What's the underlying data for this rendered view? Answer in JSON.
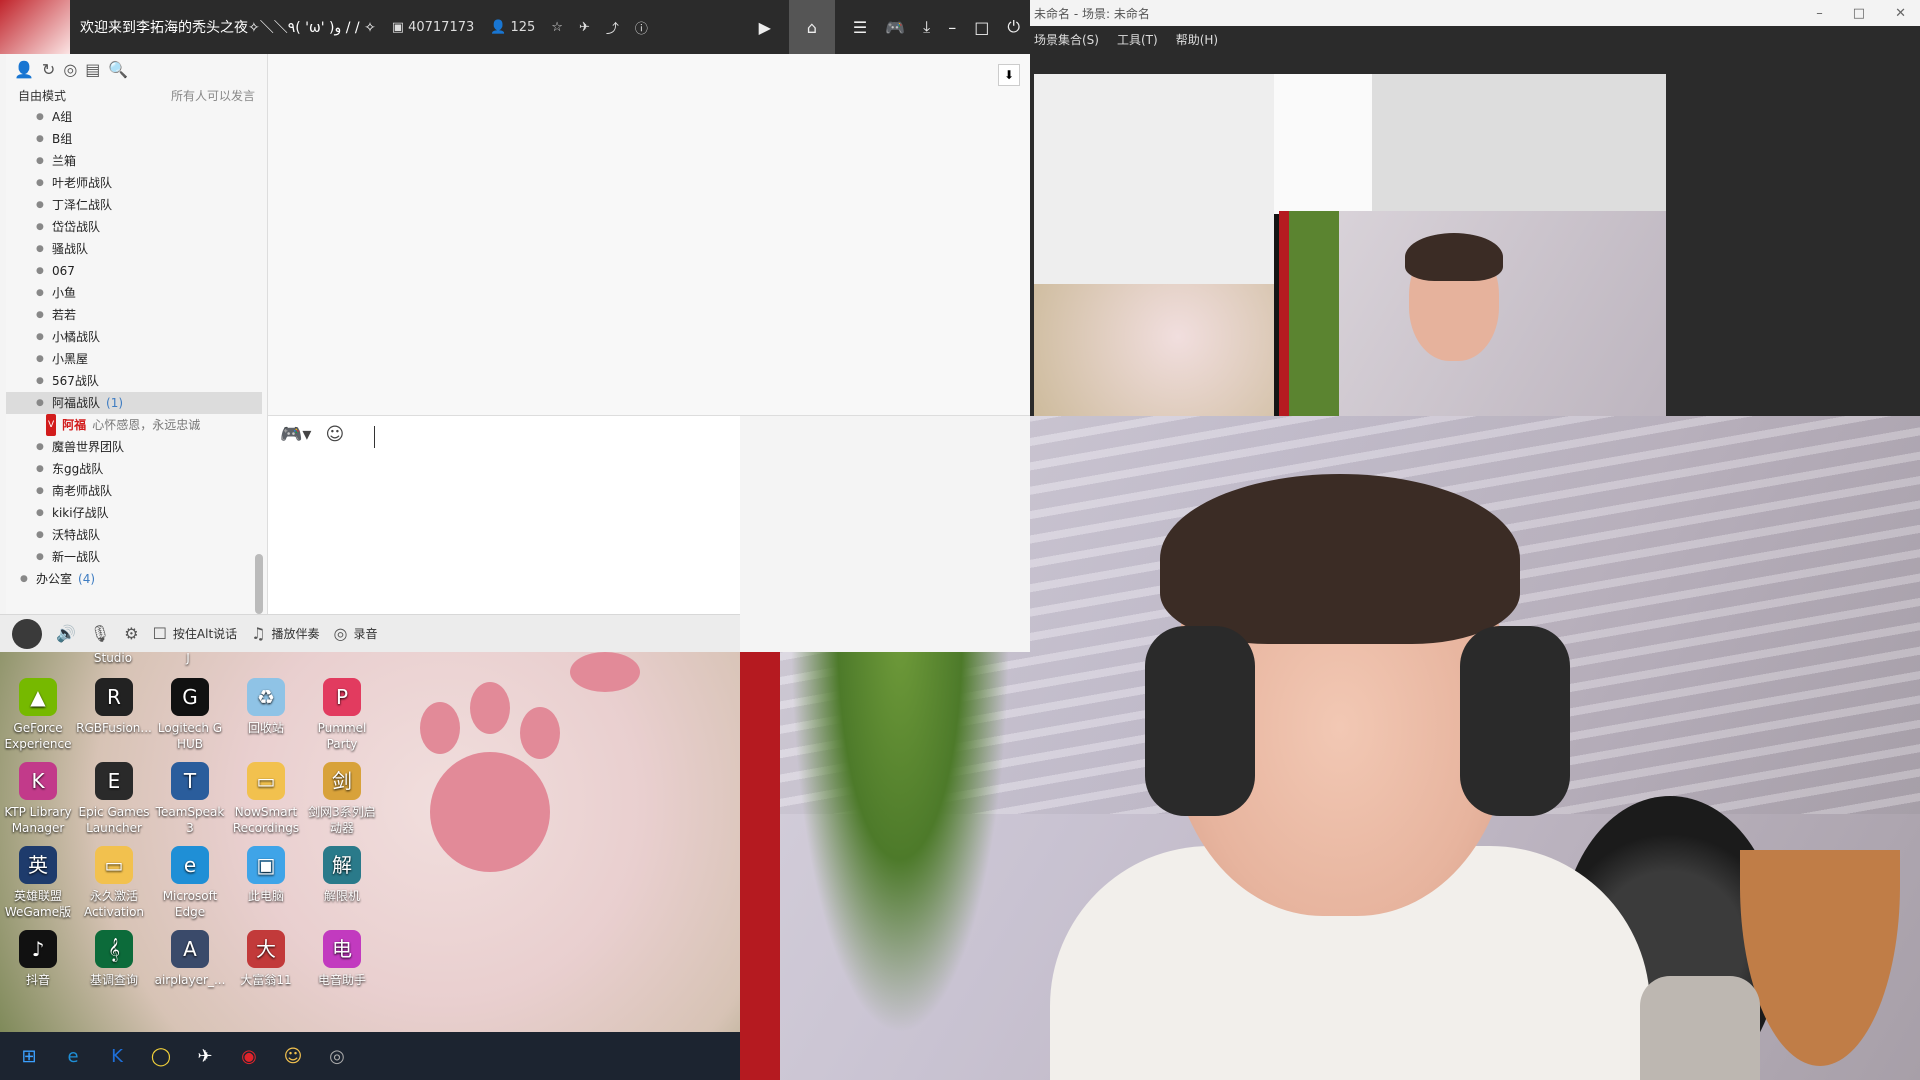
{
  "app": {
    "title": "欢迎来到李拓海的秃头之夜✧＼＼٩( 'ω' )و / / ✧",
    "channel_id": "40717173",
    "online_count": "125",
    "mode_label": "自由模式",
    "mode_hint": "所有人可以发言",
    "channels": [
      {
        "name": "A组"
      },
      {
        "name": "B组"
      },
      {
        "name": "兰箱"
      },
      {
        "name": "叶老师战队"
      },
      {
        "name": "丁泽仁战队"
      },
      {
        "name": "岱岱战队"
      },
      {
        "name": "骚战队"
      },
      {
        "name": "067"
      },
      {
        "name": "小鱼"
      },
      {
        "name": "若若"
      },
      {
        "name": "小橘战队"
      },
      {
        "name": "小黑屋"
      },
      {
        "name": "567战队"
      },
      {
        "name": "阿福战队",
        "count": "(1)"
      },
      {
        "name": "魔兽世界团队"
      },
      {
        "name": "东gg战队"
      },
      {
        "name": "南老师战队"
      },
      {
        "name": "kiki仔战队"
      },
      {
        "name": "沃特战队"
      },
      {
        "name": "新一战队"
      }
    ],
    "member": {
      "badge": "V",
      "name": "阿福",
      "signature": "心怀感恩，永远忠诚"
    },
    "folder": {
      "name": "办公室",
      "count": "(4)"
    },
    "bottom": {
      "push_to_talk": "按住Alt说话",
      "play_music": "播放伴奏",
      "record": "录音"
    }
  },
  "obs": {
    "title": "未命名 - 场景: 未命名",
    "menu": [
      "场景集合(S)",
      "工具(T)",
      "帮助(H)"
    ]
  },
  "desktop": {
    "icons": [
      {
        "label": "GeForce Experience",
        "color": "#76b900",
        "glyph": "▲"
      },
      {
        "label": "RGBFusion...",
        "color": "#222222",
        "glyph": "R"
      },
      {
        "label": "Logitech G HUB",
        "color": "#111111",
        "glyph": "G"
      },
      {
        "label": "回收站",
        "color": "#8fc3e6",
        "glyph": "♻"
      },
      {
        "label": "Pummel Party",
        "color": "#e23b5f",
        "glyph": "P"
      },
      {
        "label": "KTP Library Manager",
        "color": "#c23a8a",
        "glyph": "K"
      },
      {
        "label": "Epic Games Launcher",
        "color": "#2a2a2a",
        "glyph": "E"
      },
      {
        "label": "TeamSpeak 3",
        "color": "#2a5d9c",
        "glyph": "T"
      },
      {
        "label": "NowSmart Recordings",
        "color": "#f2c14e",
        "glyph": "▭"
      },
      {
        "label": "剑网3系列启动器",
        "color": "#d8a23a",
        "glyph": "剑"
      },
      {
        "label": "英雄联盟WeGame版",
        "color": "#1e3b6c",
        "glyph": "英"
      },
      {
        "label": "永久激活Activation",
        "color": "#f2c14e",
        "glyph": "▭"
      },
      {
        "label": "Microsoft Edge",
        "color": "#1f8fd6",
        "glyph": "e"
      },
      {
        "label": "此电脑",
        "color": "#3fa4e8",
        "glyph": "▣"
      },
      {
        "label": "解限机",
        "color": "#2a7a8a",
        "glyph": "解"
      },
      {
        "label": "抖音",
        "color": "#111111",
        "glyph": "♪"
      },
      {
        "label": "基调查询",
        "color": "#0c6b3a",
        "glyph": "𝄞"
      },
      {
        "label": "airplayer_...",
        "color": "#3a4a6a",
        "glyph": "A"
      },
      {
        "label": "大富翁11",
        "color": "#c23a3a",
        "glyph": "大"
      },
      {
        "label": "电音助手",
        "color": "#c23abf",
        "glyph": "电"
      }
    ],
    "top_labels": [
      "Studio",
      "J"
    ]
  },
  "taskbar": {
    "items": [
      {
        "name": "windows-start-icon",
        "glyph": "⊞",
        "color": "#3ba0ff"
      },
      {
        "name": "edge-icon",
        "glyph": "e",
        "color": "#1f8fd6"
      },
      {
        "name": "kugou-icon",
        "glyph": "K",
        "color": "#1e6fd9"
      },
      {
        "name": "obs-like-icon",
        "glyph": "◯",
        "color": "#f2d13a"
      },
      {
        "name": "plane-icon",
        "glyph": "✈",
        "color": "#ffffff"
      },
      {
        "name": "netease-music-icon",
        "glyph": "◉",
        "color": "#e0242b"
      },
      {
        "name": "game-avatar-icon",
        "glyph": "☺",
        "color": "#f2c14e"
      },
      {
        "name": "obs-icon",
        "glyph": "◎",
        "color": "#aaaaaa"
      }
    ]
  }
}
